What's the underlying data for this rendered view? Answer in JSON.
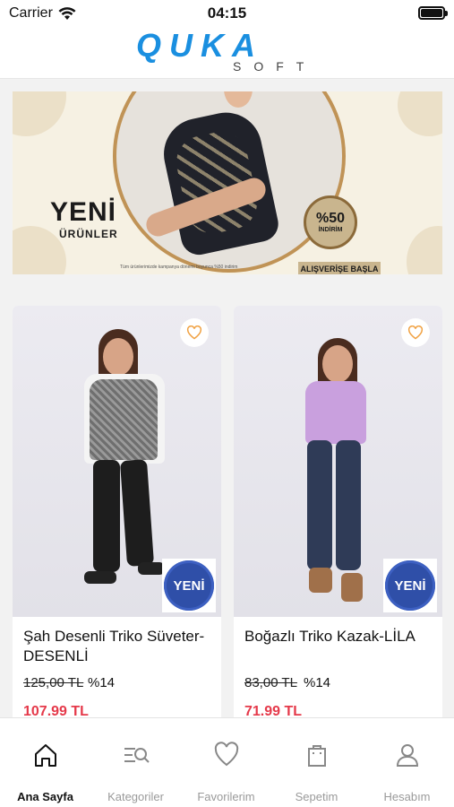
{
  "status_bar": {
    "carrier": "Carrier",
    "time": "04:15"
  },
  "header": {
    "logo_main": "QUKA",
    "logo_sub": "SOFT",
    "brand_color": "#1a8fe0"
  },
  "banner": {
    "title": "YENİ",
    "subtitle": "ÜRÜNLER",
    "discount": "%50",
    "discount_label": "İNDİRİM",
    "cta": "ALIŞVERİŞE BAŞLA",
    "fine_print": "Tüm ürünlerimizde kampanya dönemi boyunca %50 indirim"
  },
  "products": [
    {
      "name": "Şah Desenli Triko Süveter-DESENLİ",
      "old_price": "125,00 TL",
      "discount": "%14",
      "price": "107.99 TL",
      "badge": "YENİ",
      "favorite_icon": "heart-icon"
    },
    {
      "name": "Boğazlı Triko Kazak-LİLA",
      "old_price": "83,00 TL",
      "discount": "%14",
      "price": "71.99 TL",
      "badge": "YENİ",
      "favorite_icon": "heart-icon"
    }
  ],
  "tabs": [
    {
      "label": "Ana Sayfa",
      "icon": "home-icon",
      "active": true
    },
    {
      "label": "Kategoriler",
      "icon": "category-search-icon",
      "active": false
    },
    {
      "label": "Favorilerim",
      "icon": "heart-icon",
      "active": false
    },
    {
      "label": "Sepetim",
      "icon": "shopping-bag-icon",
      "active": false
    },
    {
      "label": "Hesabım",
      "icon": "user-icon",
      "active": false
    }
  ],
  "colors": {
    "price": "#e5394a",
    "favorite": "#f0a040",
    "badge": "#2f4fa8"
  }
}
